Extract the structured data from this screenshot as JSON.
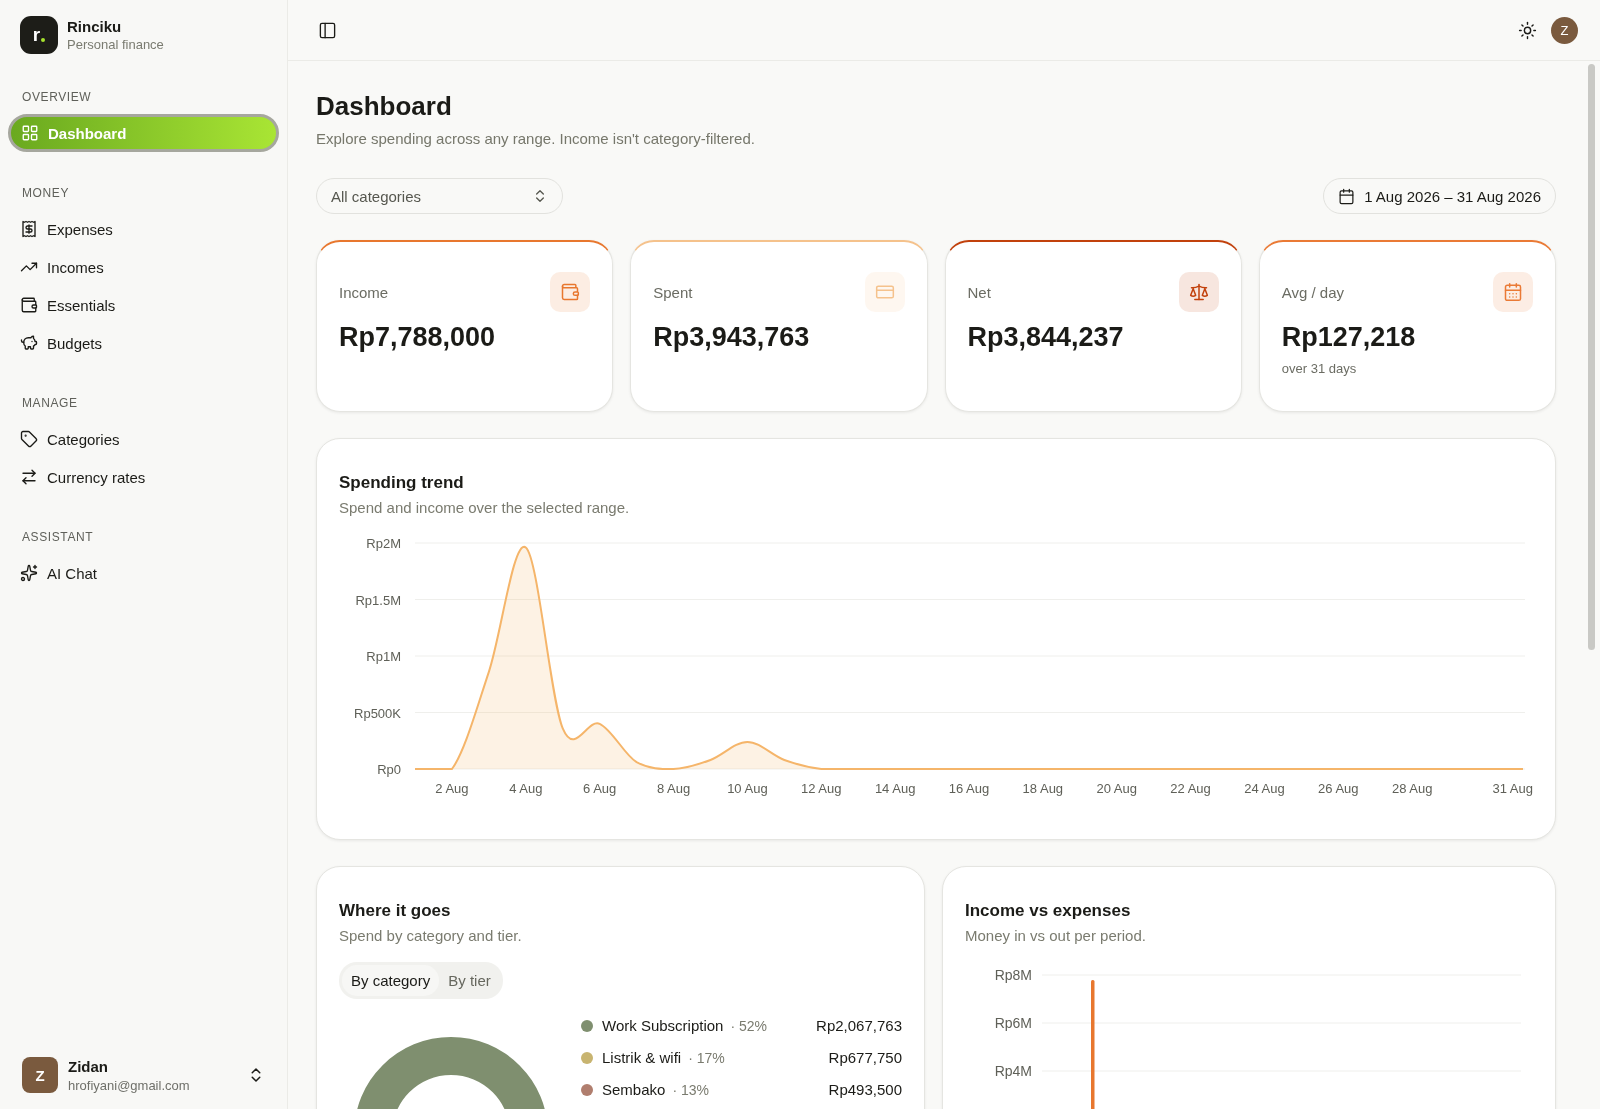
{
  "brand": {
    "logo_text": "r",
    "name": "Rinciku",
    "tagline": "Personal finance"
  },
  "sidebar": {
    "sections": [
      {
        "title": "OVERVIEW",
        "items": [
          {
            "label": "Dashboard",
            "selected": true
          }
        ]
      },
      {
        "title": "MONEY",
        "items": [
          {
            "label": "Expenses",
            "selected": false
          },
          {
            "label": "Incomes",
            "selected": false
          },
          {
            "label": "Essentials",
            "selected": false
          },
          {
            "label": "Budgets",
            "selected": false
          }
        ]
      },
      {
        "title": "MANAGE",
        "items": [
          {
            "label": "Categories",
            "selected": false
          },
          {
            "label": "Currency rates",
            "selected": false
          }
        ]
      },
      {
        "title": "ASSISTANT",
        "items": [
          {
            "label": "AI Chat",
            "selected": false
          }
        ]
      }
    ]
  },
  "user": {
    "initial": "Z",
    "name": "Zidan",
    "email": "hrofiyani@gmail.com"
  },
  "topbar": {
    "avatar_initial": "Z"
  },
  "page": {
    "title": "Dashboard",
    "subtitle": "Explore spending across any range. Income isn't category-filtered."
  },
  "filter": {
    "value": "All categories"
  },
  "date_range": "1 Aug 2026 – 31 Aug 2026",
  "stats": [
    {
      "label": "Income",
      "value": "Rp7,788,000",
      "color": "#e8772e"
    },
    {
      "label": "Spent",
      "value": "Rp3,943,763",
      "color": "#f5c28c"
    },
    {
      "label": "Net",
      "value": "Rp3,844,237",
      "color": "#c2410c"
    },
    {
      "label": "Avg / day",
      "value": "Rp127,218",
      "note": "over 31 days",
      "color": "#ea7a35"
    }
  ],
  "trend": {
    "title": "Spending trend",
    "subtitle": "Spend and income over the selected range.",
    "x_axis_labels": [
      "2 Aug",
      "4 Aug",
      "6 Aug",
      "8 Aug",
      "10 Aug",
      "12 Aug",
      "14 Aug",
      "16 Aug",
      "18 Aug",
      "20 Aug",
      "22 Aug",
      "24 Aug",
      "26 Aug",
      "28 Aug",
      "31 Aug"
    ],
    "y_axis_labels": [
      "Rp2M",
      "Rp1.5M",
      "Rp1M",
      "Rp500K",
      "Rp0"
    ]
  },
  "breakdown": {
    "title": "Where it goes",
    "subtitle": "Spend by category and tier.",
    "tabs": [
      {
        "label": "By category",
        "selected": true
      },
      {
        "label": "By tier",
        "selected": false
      }
    ],
    "legend": [
      {
        "name": "Work Subscription",
        "share": "· 52%",
        "amount": "Rp2,067,763",
        "color": "#7f8f6f"
      },
      {
        "name": "Listrik & wifi",
        "share": "· 17%",
        "amount": "Rp677,750",
        "color": "#c8b470"
      },
      {
        "name": "Sembako",
        "share": "· 13%",
        "amount": "Rp493,500",
        "color": "#b07e6e"
      }
    ]
  },
  "comparison": {
    "title": "Income vs expenses",
    "subtitle": "Money in vs out per period.",
    "y_axis_labels": [
      "Rp8M",
      "Rp6M",
      "Rp4M"
    ]
  }
}
